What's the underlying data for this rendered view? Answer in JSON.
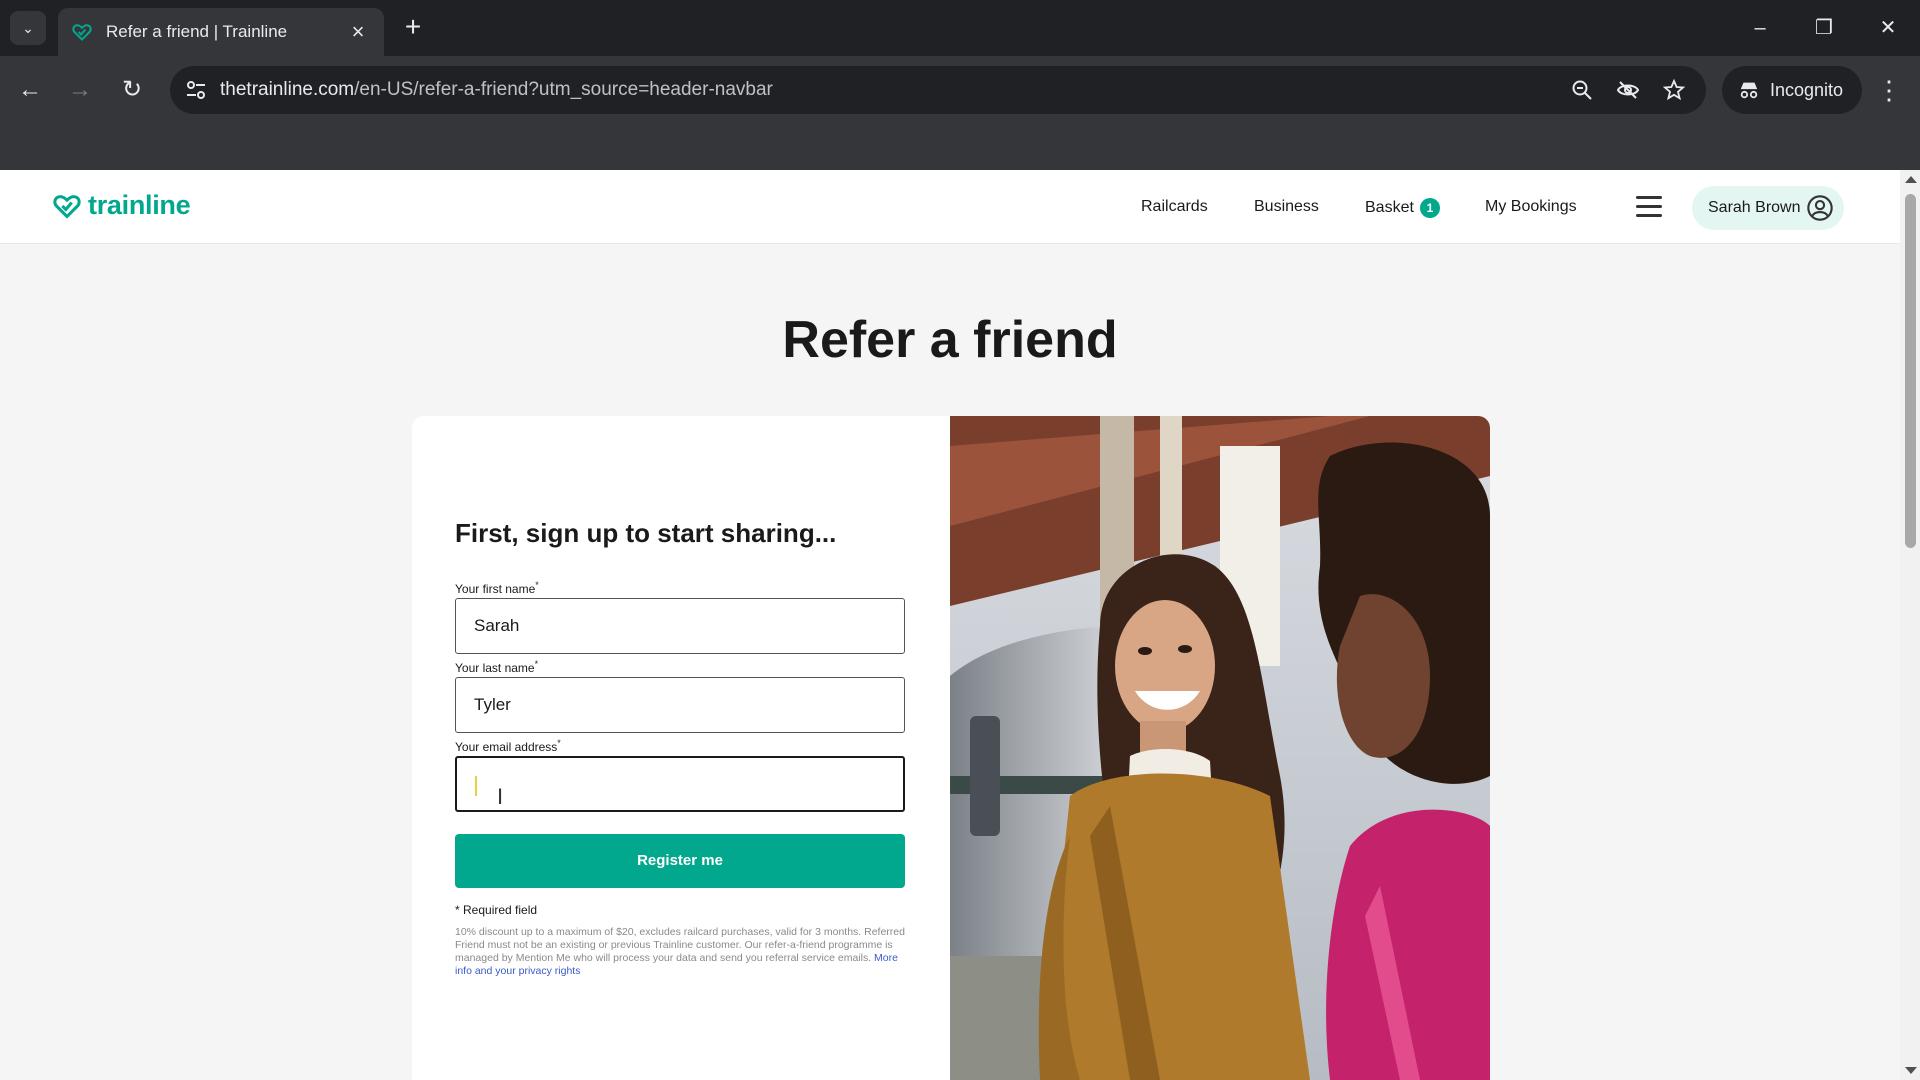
{
  "browser": {
    "tab_title": "Refer a friend | Trainline",
    "url_host": "thetrainline.com",
    "url_path": "/en-US/refer-a-friend?utm_source=header-navbar",
    "incognito_label": "Incognito",
    "icons": [
      "tab-search-icon",
      "close-icon",
      "plus-icon",
      "minimize-icon",
      "restore-icon",
      "back-icon",
      "forward-icon",
      "reload-icon",
      "site-info-icon",
      "zoom-icon",
      "eye-off-icon",
      "star-icon",
      "incognito-icon",
      "kebab-menu-icon"
    ]
  },
  "header": {
    "logo_text": "trainline",
    "nav": {
      "railcards": "Railcards",
      "business": "Business",
      "basket": "Basket",
      "basket_count": "1",
      "bookings": "My Bookings"
    },
    "account_name": "Sarah Brown"
  },
  "page": {
    "title": "Refer a friend"
  },
  "form": {
    "heading": "First, sign up to start sharing...",
    "first_name_label": "Your first name",
    "first_name_value": "Sarah",
    "last_name_label": "Your last name",
    "last_name_value": "Tyler",
    "email_label": "Your email address",
    "email_value": "",
    "required_mark": "*",
    "register_label": "Register me",
    "required_note": "* Required field",
    "disclaimer": "10% discount up to a maximum of $20, excludes railcard purchases, valid for 3 months. Referred Friend must not be an existing or previous Trainline customer. Our refer-a-friend programme is managed by Mention Me who will process your data and send you referral service emails.",
    "privacy_link": "More info and your privacy rights"
  },
  "colors": {
    "brand": "#01a88d",
    "chrome_dark": "#202124",
    "chrome_tab": "#35363a"
  }
}
